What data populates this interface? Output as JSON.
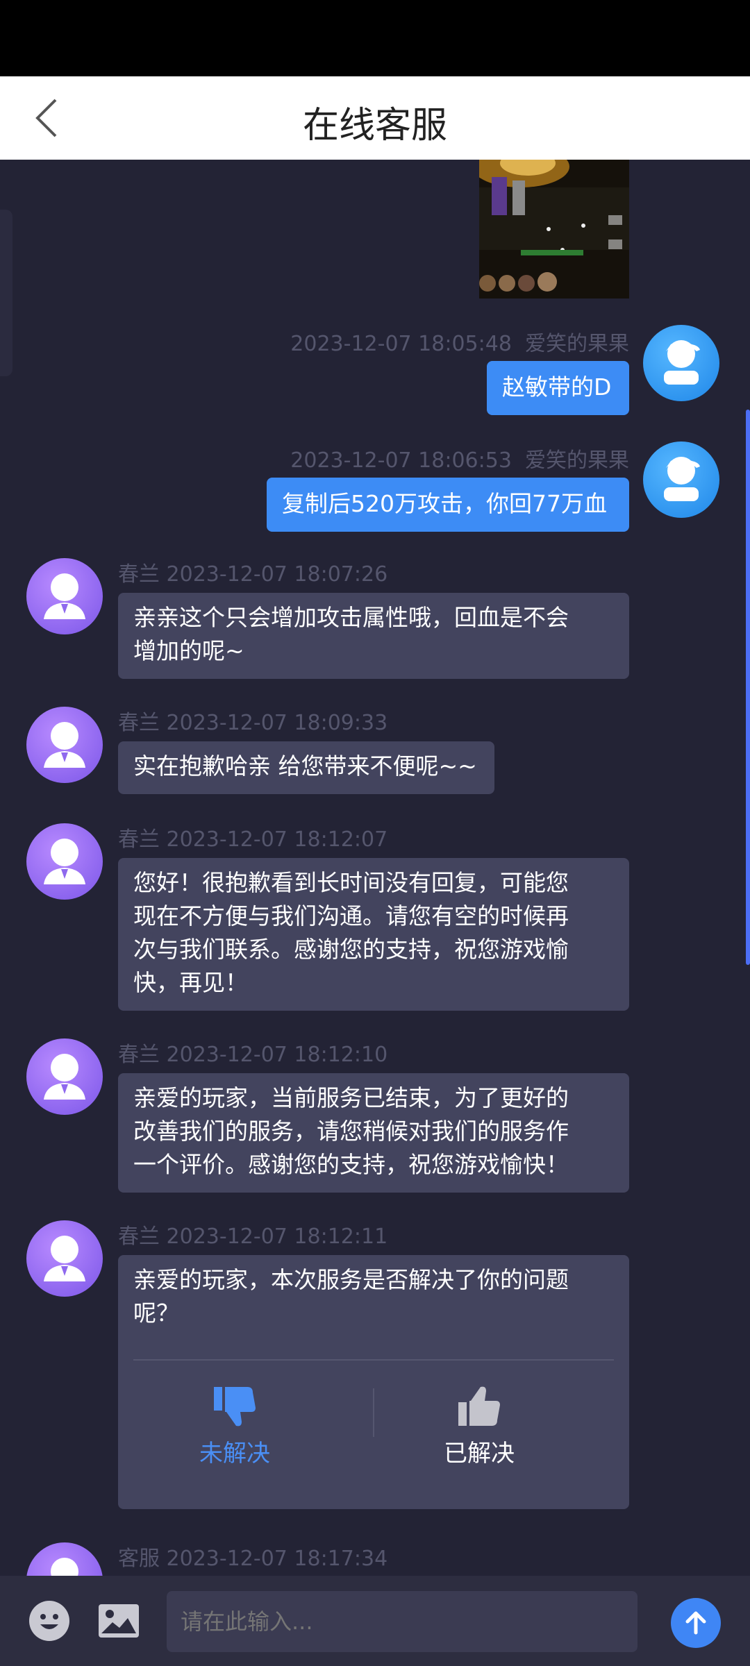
{
  "header": {
    "title": "在线客服"
  },
  "messages": [
    {
      "sender": "爱笑的果果",
      "time": "2023-12-07 18:05:48",
      "text": "赵敏带的D"
    },
    {
      "sender": "爱笑的果果",
      "time": "2023-12-07 18:06:53",
      "text": "复制后520万攻击，你回77万血"
    },
    {
      "sender": "春兰",
      "time": "2023-12-07 18:07:26",
      "lines": [
        "亲亲这个只会增加攻击属性哦，回血是不会",
        "增加的呢~"
      ]
    },
    {
      "sender": "春兰",
      "time": "2023-12-07 18:09:33",
      "text": "实在抱歉哈亲 给您带来不便呢~~"
    },
    {
      "sender": "春兰",
      "time": "2023-12-07 18:12:07",
      "lines": [
        "您好！很抱歉看到长时间没有回复，可能您",
        "现在不方便与我们沟通。请您有空的时候再",
        "次与我们联系。感谢您的支持，祝您游戏愉",
        "快，再见！"
      ]
    },
    {
      "sender": "春兰",
      "time": "2023-12-07 18:12:10",
      "lines": [
        "亲爱的玩家，当前服务已结束，为了更好的",
        "改善我们的服务，请您稍候对我们的服务作",
        "一个评价。感谢您的支持，祝您游戏愉快！"
      ]
    },
    {
      "sender": "春兰",
      "time": "2023-12-07 18:12:11",
      "lines": [
        "亲爱的玩家，本次服务是否解决了你的问题",
        "呢？"
      ],
      "rating": {
        "unresolved": "未解决",
        "resolved": "已解决"
      }
    },
    {
      "sender": "客服",
      "time": "2023-12-07 18:17:34"
    }
  ],
  "input": {
    "placeholder": "请在此输入..."
  },
  "colors": {
    "accent": "#3d8cf5",
    "background": "#232335",
    "agent_bubble": "#43445e"
  }
}
